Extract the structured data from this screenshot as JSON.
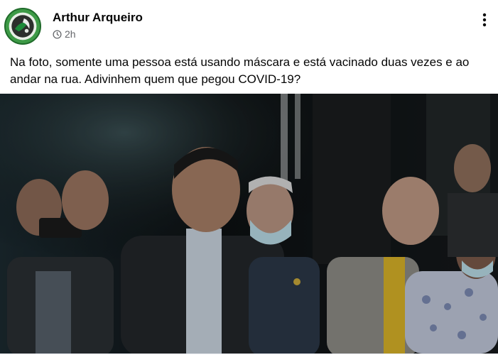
{
  "post": {
    "author": "Arthur Arqueiro",
    "timestamp": "2h",
    "text": "Na foto, somente uma pessoa está usando máscara e está vacinado duas vezes e ao andar na rua. Adivinhem quem que pegou COVID-19?"
  },
  "icons": {
    "clock": "clock-icon",
    "more": "more-options-icon"
  },
  "colors": {
    "text_primary": "#050505",
    "text_secondary": "#65676b",
    "avatar_green": "#2f8a3a"
  }
}
